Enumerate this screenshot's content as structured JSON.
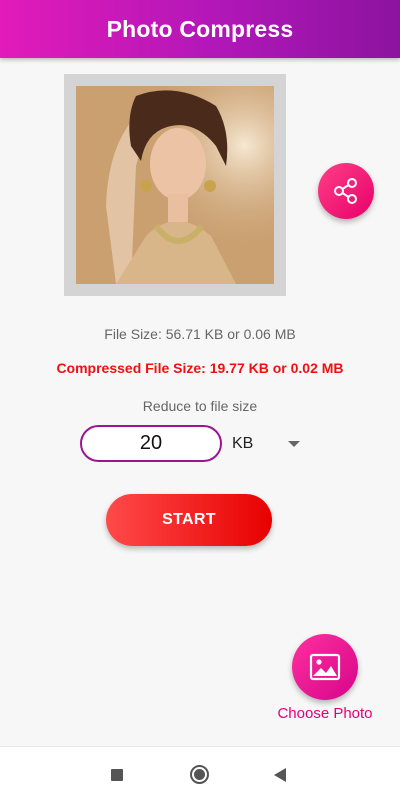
{
  "app_bar": {
    "title": "Photo Compress"
  },
  "photo": {
    "subject": "portrait-photo"
  },
  "info": {
    "file_size": "File Size: 56.71 KB or 0.06 MB",
    "compressed_file_size": "Compressed File Size: 19.77 KB or 0.02 MB",
    "reduce_label": "Reduce to file size"
  },
  "size_input": {
    "value": "20"
  },
  "unit_select": {
    "selected": "KB"
  },
  "start_button": {
    "label": "START"
  },
  "choose_photo": {
    "label": "Choose Photo"
  },
  "colors": {
    "app_bar_gradient_start": "#e21bb9",
    "app_bar_gradient_end": "#8c139f",
    "compressed_text": "#ee1111",
    "start_button": "#f02222",
    "choose_photo_accent": "#e5007a"
  },
  "icons": {
    "share": "share-icon",
    "choose_photo": "image-icon",
    "dropdown": "chevron-down-icon",
    "nav_recent": "recent-apps-icon",
    "nav_home": "home-icon",
    "nav_back": "back-icon"
  }
}
